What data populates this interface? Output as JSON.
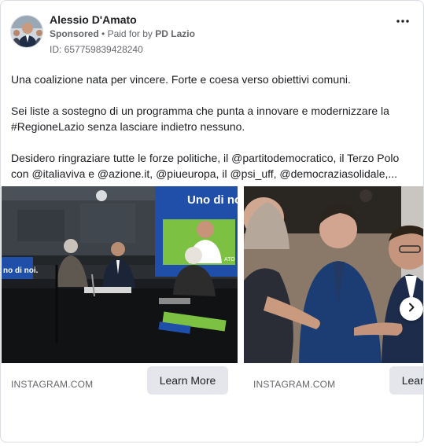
{
  "ad": {
    "advertiser_name": "Alessio D'Amato",
    "sponsored_label": "Sponsored",
    "separator": "•",
    "paid_for_prefix": "Paid for by",
    "paid_for_by": "PD Lazio",
    "id_label": "ID: 657759839428240",
    "more_icon": "more-horizontal-icon"
  },
  "body": {
    "paragraph_1": "Una coalizione nata per vincere. Forte e coesa verso obiettivi comuni.",
    "paragraph_2": "Sei liste a sostegno di un programma che punta a innovare e modernizzare la #RegioneLazio senza lasciare indietro nessuno.",
    "paragraph_3": "Desidero ringraziare tutte le forze politiche, il @partitodemocratico, il Terzo Polo con @italiaviva e @azione.it, @piueuropa, il @psi_uff, @democraziasolidale,..."
  },
  "carousel": {
    "cards": [
      {
        "domain": "INSTAGRAM.COM",
        "cta": "Learn More",
        "banner_text": "Uno di noi.",
        "table_sign": "no di noi.",
        "banner_small": "ATO"
      },
      {
        "domain": "INSTAGRAM.COM",
        "cta": "Learn More"
      }
    ],
    "next_icon": "chevron-right-icon"
  },
  "colors": {
    "link_text": "#1c1e21",
    "secondary_text": "#65676b",
    "button_bg": "#e4e6eb",
    "banner_blue": "#1f4fa8",
    "banner_green": "#7cc142"
  }
}
